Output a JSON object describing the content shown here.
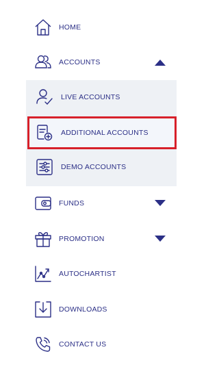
{
  "menu": {
    "home": {
      "label": "HOME",
      "icon": "home-icon"
    },
    "accounts": {
      "label": "ACCOUNTS",
      "icon": "users-icon",
      "expanded": true
    },
    "live_accounts": {
      "label": "LIVE ACCOUNTS",
      "icon": "user-check-icon"
    },
    "additional_accounts": {
      "label": "ADDITIONAL ACCOUNTS",
      "icon": "add-document-icon",
      "selected": true
    },
    "demo_accounts": {
      "label": "DEMO ACCOUNTS",
      "icon": "sliders-icon"
    },
    "funds": {
      "label": "FUNDS",
      "icon": "wallet-icon",
      "expanded": false
    },
    "promotion": {
      "label": "PROMOTION",
      "icon": "gift-icon",
      "expanded": false
    },
    "autochartist": {
      "label": "AUTOCHARTIST",
      "icon": "chart-icon"
    },
    "downloads": {
      "label": "DOWNLOADS",
      "icon": "download-icon"
    },
    "contact_us": {
      "label": "CONTACT US",
      "icon": "phone-icon"
    }
  },
  "colors": {
    "accent": "#2b2f86",
    "submenu_bg": "#eef1f5",
    "highlight_border": "#d7202a"
  }
}
